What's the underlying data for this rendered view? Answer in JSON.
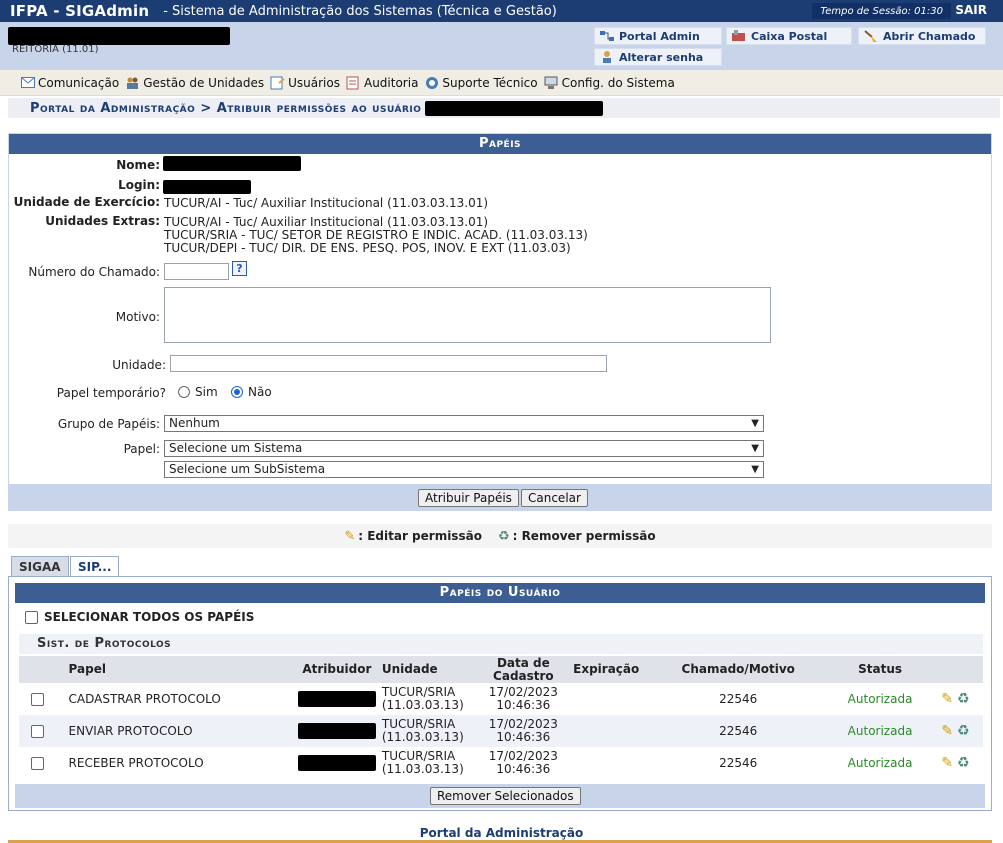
{
  "header": {
    "system": "IFPA - SIGAdmin",
    "subtitle": "- Sistema de Administração dos Sistemas (Técnica e Gestão)",
    "session_label": "Tempo de Sessão: 01:30",
    "exit_label": "SAIR"
  },
  "user": {
    "unit": "REITORIA (11.01)"
  },
  "quick_links": {
    "portal_admin": "Portal Admin",
    "caixa_postal": "Caixa Postal",
    "abrir_chamado": "Abrir Chamado",
    "alterar_senha": "Alterar senha"
  },
  "menu": {
    "items": [
      {
        "label": "Comunicação",
        "icon": "mail-icon"
      },
      {
        "label": "Gestão de Unidades",
        "icon": "people-icon"
      },
      {
        "label": "Usuários",
        "icon": "users-icon"
      },
      {
        "label": "Auditoria",
        "icon": "audit-icon"
      },
      {
        "label": "Suporte Técnico",
        "icon": "support-icon"
      },
      {
        "label": "Config. do Sistema",
        "icon": "computer-icon"
      }
    ]
  },
  "breadcrumb": {
    "text": "Portal da Administração > Atribuir permissões ao usuário"
  },
  "form": {
    "title": "Papéis",
    "nome_label": "Nome:",
    "login_label": "Login:",
    "unidade_exercicio_label": "Unidade de Exercício:",
    "unidade_exercicio_value": "TUCUR/AI - Tuc/ Auxiliar Institucional (11.03.03.13.01)",
    "unidades_extras_label": "Unidades Extras:",
    "unidades_extras": [
      "TUCUR/AI - Tuc/ Auxiliar Institucional (11.03.03.13.01)",
      "TUCUR/SRIA - TUC/ SETOR DE REGISTRO E INDIC. ACAD. (11.03.03.13)",
      "TUCUR/DEPI - TUC/ DIR. DE ENS. PESQ. POS, INOV. E EXT (11.03.03)"
    ],
    "numero_chamado_label": "Número do Chamado:",
    "help_symbol": "?",
    "motivo_label": "Motivo:",
    "unidade_label": "Unidade:",
    "papel_temporario_label": "Papel temporário?",
    "sim_label": "Sim",
    "nao_label": "Não",
    "grupo_label": "Grupo de Papéis:",
    "grupo_value": "Nenhum",
    "papel_label": "Papel:",
    "sistema_value": "Selecione um Sistema",
    "subsistema_value": "Selecione um SubSistema",
    "atribuir_button": "Atribuir Papéis",
    "cancelar_button": "Cancelar"
  },
  "legend": {
    "editar": ": Editar permissão",
    "remover": ": Remover permissão"
  },
  "tabs": [
    {
      "label": "SIGAA",
      "active": false
    },
    {
      "label": "SIP...",
      "active": true
    }
  ],
  "roles": {
    "title": "Papéis do Usuário",
    "select_all": "SELECIONAR TODOS OS PAPÉIS",
    "system_header": "Sist. de Protocolos",
    "columns": {
      "papel": "Papel",
      "atribuidor": "Atribuidor",
      "unidade": "Unidade",
      "data_1": "Data de",
      "data_2": "Cadastro",
      "expiracao": "Expiração",
      "chamado": "Chamado/Motivo",
      "status": "Status"
    },
    "rows": [
      {
        "papel": "CADASTRAR PROTOCOLO",
        "unidade_1": "TUCUR/SRIA",
        "unidade_2": "(11.03.03.13)",
        "data_1": "17/02/2023",
        "data_2": "10:46:36",
        "expiracao": "",
        "chamado": "22546",
        "status": "Autorizada"
      },
      {
        "papel": "ENVIAR PROTOCOLO",
        "unidade_1": "TUCUR/SRIA",
        "unidade_2": "(11.03.03.13)",
        "data_1": "17/02/2023",
        "data_2": "10:46:36",
        "expiracao": "",
        "chamado": "22546",
        "status": "Autorizada"
      },
      {
        "papel": "RECEBER PROTOCOLO",
        "unidade_1": "TUCUR/SRIA",
        "unidade_2": "(11.03.03.13)",
        "data_1": "17/02/2023",
        "data_2": "10:46:36",
        "expiracao": "",
        "chamado": "22546",
        "status": "Autorizada"
      }
    ],
    "remove_selected_button": "Remover Selecionados"
  },
  "footer": {
    "link": "Portal da Administração"
  },
  "colors": {
    "header_bg": "#1c3c74",
    "caption_bg": "#3d5e93",
    "light_blue": "#c8d4e9",
    "status_green": "#2a8a2a"
  }
}
